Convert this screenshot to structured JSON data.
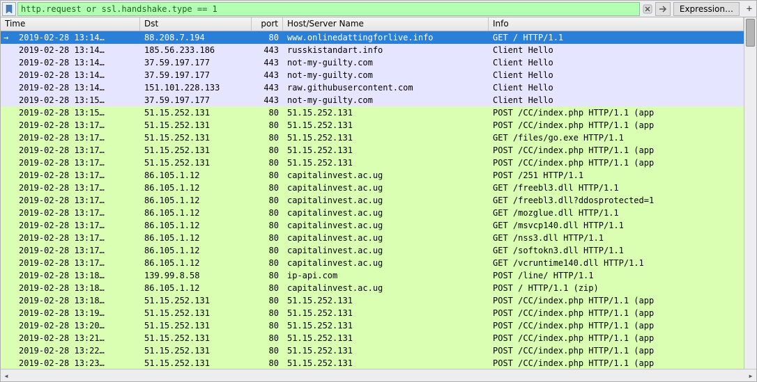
{
  "filter": {
    "value": "http.request or ssl.handshake.type == 1",
    "expression_label": "Expression…"
  },
  "columns": {
    "time": "Time",
    "dst": "Dst",
    "port": "port",
    "host": "Host/Server Name",
    "info": "Info"
  },
  "rows": [
    {
      "selected": true,
      "bg": "http",
      "time": "2019-02-28 13:14…",
      "dst": "88.208.7.194",
      "port": "80",
      "host": "www.onlinedattingforlive.info",
      "info": "GET / HTTP/1.1"
    },
    {
      "bg": "tcp",
      "time": "2019-02-28 13:14…",
      "dst": "185.56.233.186",
      "port": "443",
      "host": "russkistandart.info",
      "info": "Client Hello"
    },
    {
      "bg": "tcp",
      "time": "2019-02-28 13:14…",
      "dst": "37.59.197.177",
      "port": "443",
      "host": "not-my-guilty.com",
      "info": "Client Hello"
    },
    {
      "bg": "tcp",
      "time": "2019-02-28 13:14…",
      "dst": "37.59.197.177",
      "port": "443",
      "host": "not-my-guilty.com",
      "info": "Client Hello"
    },
    {
      "bg": "tcp",
      "time": "2019-02-28 13:14…",
      "dst": "151.101.228.133",
      "port": "443",
      "host": "raw.githubusercontent.com",
      "info": "Client Hello"
    },
    {
      "bg": "tcp",
      "time": "2019-02-28 13:15…",
      "dst": "37.59.197.177",
      "port": "443",
      "host": "not-my-guilty.com",
      "info": "Client Hello"
    },
    {
      "bg": "http",
      "time": "2019-02-28 13:15…",
      "dst": "51.15.252.131",
      "port": "80",
      "host": "51.15.252.131",
      "info": "POST /CC/index.php HTTP/1.1  (app"
    },
    {
      "bg": "http",
      "time": "2019-02-28 13:17…",
      "dst": "51.15.252.131",
      "port": "80",
      "host": "51.15.252.131",
      "info": "POST /CC/index.php HTTP/1.1  (app"
    },
    {
      "bg": "http",
      "time": "2019-02-28 13:17…",
      "dst": "51.15.252.131",
      "port": "80",
      "host": "51.15.252.131",
      "info": "GET /files/go.exe HTTP/1.1"
    },
    {
      "bg": "http",
      "time": "2019-02-28 13:17…",
      "dst": "51.15.252.131",
      "port": "80",
      "host": "51.15.252.131",
      "info": "POST /CC/index.php HTTP/1.1  (app"
    },
    {
      "bg": "http",
      "time": "2019-02-28 13:17…",
      "dst": "51.15.252.131",
      "port": "80",
      "host": "51.15.252.131",
      "info": "POST /CC/index.php HTTP/1.1  (app"
    },
    {
      "bg": "http",
      "time": "2019-02-28 13:17…",
      "dst": "86.105.1.12",
      "port": "80",
      "host": "capitalinvest.ac.ug",
      "info": "POST /251 HTTP/1.1"
    },
    {
      "bg": "http",
      "time": "2019-02-28 13:17…",
      "dst": "86.105.1.12",
      "port": "80",
      "host": "capitalinvest.ac.ug",
      "info": "GET /freebl3.dll HTTP/1.1"
    },
    {
      "bg": "http",
      "time": "2019-02-28 13:17…",
      "dst": "86.105.1.12",
      "port": "80",
      "host": "capitalinvest.ac.ug",
      "info": "GET /freebl3.dll?ddosprotected=1"
    },
    {
      "bg": "http",
      "time": "2019-02-28 13:17…",
      "dst": "86.105.1.12",
      "port": "80",
      "host": "capitalinvest.ac.ug",
      "info": "GET /mozglue.dll HTTP/1.1"
    },
    {
      "bg": "http",
      "time": "2019-02-28 13:17…",
      "dst": "86.105.1.12",
      "port": "80",
      "host": "capitalinvest.ac.ug",
      "info": "GET /msvcp140.dll HTTP/1.1"
    },
    {
      "bg": "http",
      "time": "2019-02-28 13:17…",
      "dst": "86.105.1.12",
      "port": "80",
      "host": "capitalinvest.ac.ug",
      "info": "GET /nss3.dll HTTP/1.1"
    },
    {
      "bg": "http",
      "time": "2019-02-28 13:17…",
      "dst": "86.105.1.12",
      "port": "80",
      "host": "capitalinvest.ac.ug",
      "info": "GET /softokn3.dll HTTP/1.1"
    },
    {
      "bg": "http",
      "time": "2019-02-28 13:17…",
      "dst": "86.105.1.12",
      "port": "80",
      "host": "capitalinvest.ac.ug",
      "info": "GET /vcruntime140.dll HTTP/1.1"
    },
    {
      "bg": "http",
      "time": "2019-02-28 13:18…",
      "dst": "139.99.8.58",
      "port": "80",
      "host": "ip-api.com",
      "info": "POST /line/ HTTP/1.1"
    },
    {
      "bg": "http",
      "time": "2019-02-28 13:18…",
      "dst": "86.105.1.12",
      "port": "80",
      "host": "capitalinvest.ac.ug",
      "info": "POST / HTTP/1.1  (zip)"
    },
    {
      "bg": "http",
      "time": "2019-02-28 13:18…",
      "dst": "51.15.252.131",
      "port": "80",
      "host": "51.15.252.131",
      "info": "POST /CC/index.php HTTP/1.1  (app"
    },
    {
      "bg": "http",
      "time": "2019-02-28 13:19…",
      "dst": "51.15.252.131",
      "port": "80",
      "host": "51.15.252.131",
      "info": "POST /CC/index.php HTTP/1.1  (app"
    },
    {
      "bg": "http",
      "time": "2019-02-28 13:20…",
      "dst": "51.15.252.131",
      "port": "80",
      "host": "51.15.252.131",
      "info": "POST /CC/index.php HTTP/1.1  (app"
    },
    {
      "bg": "http",
      "time": "2019-02-28 13:21…",
      "dst": "51.15.252.131",
      "port": "80",
      "host": "51.15.252.131",
      "info": "POST /CC/index.php HTTP/1.1  (app"
    },
    {
      "bg": "http",
      "time": "2019-02-28 13:22…",
      "dst": "51.15.252.131",
      "port": "80",
      "host": "51.15.252.131",
      "info": "POST /CC/index.php HTTP/1.1  (app"
    },
    {
      "bg": "http",
      "time": "2019-02-28 13:23…",
      "dst": "51.15.252.131",
      "port": "80",
      "host": "51.15.252.131",
      "info": "POST /CC/index.php HTTP/1.1  (app"
    }
  ]
}
